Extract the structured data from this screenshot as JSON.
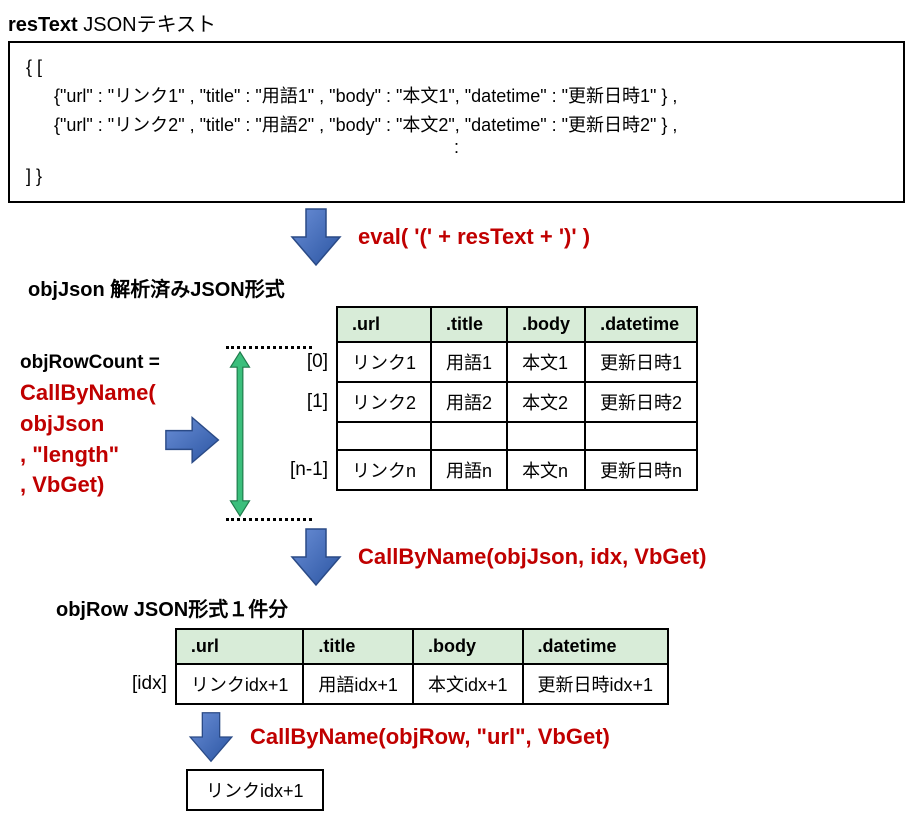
{
  "header": {
    "var": "resText",
    "jp": " JSONテキスト"
  },
  "json_box": {
    "open": "{ [",
    "row1": "{\"url\" : \"リンク1\" , \"title\" : \"用語1\" , \"body\" : \"本文1\", \"datetime\" : \"更新日時1\" } ,",
    "row2": "{\"url\" : \"リンク2\" , \"title\" : \"用語2\" , \"body\" : \"本文2\", \"datetime\" : \"更新日時2\" } ,",
    "dots": ":",
    "close": "] }"
  },
  "step1_label": "eval( '(' + resText + ')' )",
  "objjson_label": {
    "var": "objJson",
    "jp": " 解析済みJSON形式"
  },
  "objrowcount_label": "objRowCount =",
  "call_length": "CallByName(\nobjJson\n, \"length\"\n, VbGet)",
  "table1": {
    "headers": [
      ".url",
      ".title",
      ".body",
      ".datetime"
    ],
    "indices": [
      "[0]",
      "[1]",
      "[n-1]"
    ],
    "rows": [
      [
        "リンク1",
        "用語1",
        "本文1",
        "更新日時1"
      ],
      [
        "リンク2",
        "用語2",
        "本文2",
        "更新日時2"
      ],
      [
        "リンクn",
        "用語n",
        "本文n",
        "更新日時n"
      ]
    ]
  },
  "step2_label": "CallByName(objJson, idx, VbGet)",
  "objrow_label": {
    "var": "objRow",
    "jp": " JSON形式１件分"
  },
  "table2": {
    "headers": [
      ".url",
      ".title",
      ".body",
      ".datetime"
    ],
    "index": "[idx]",
    "row": [
      "リンクidx+1",
      "用語idx+1",
      "本文idx+1",
      "更新日時idx+1"
    ]
  },
  "step3_label": "CallByName(objRow, \"url\", VbGet)",
  "result": "リンクidx+1"
}
